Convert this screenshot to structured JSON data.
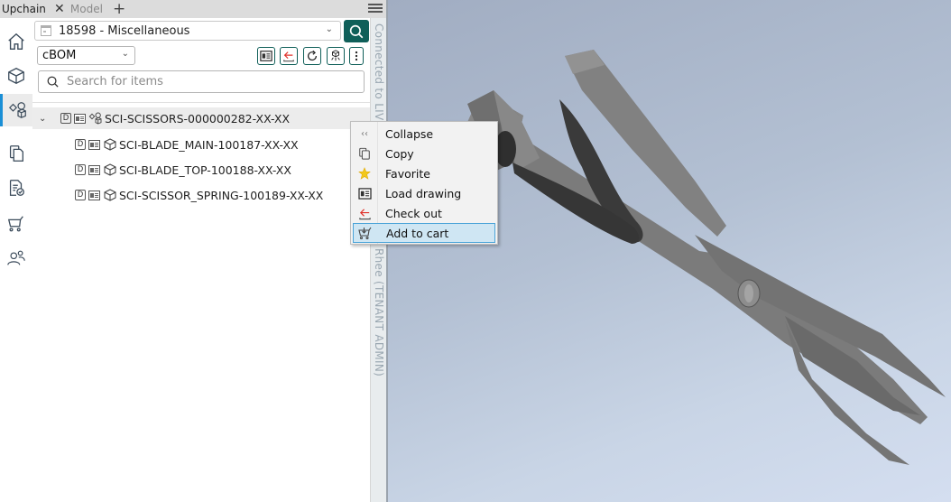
{
  "tabs": [
    {
      "label": "Upchain",
      "active": true
    },
    {
      "label": "Model",
      "active": false
    }
  ],
  "tab_add_icon": "plus-icon",
  "menu_icon": "hamburger-icon",
  "leftnav": [
    {
      "id": "home",
      "icon": "home-icon",
      "active": false
    },
    {
      "id": "parts",
      "icon": "cube-icon",
      "active": false
    },
    {
      "id": "assemblies",
      "icon": "assembly-icon",
      "active": true
    },
    {
      "id": "documents",
      "icon": "documents-icon",
      "active": false
    },
    {
      "id": "approvals",
      "icon": "document-check-icon",
      "active": false
    },
    {
      "id": "cart",
      "icon": "cart-icon",
      "active": false
    },
    {
      "id": "users",
      "icon": "users-icon",
      "active": false
    }
  ],
  "project": {
    "selected": "18598 - Miscellaneous"
  },
  "bom": {
    "selected": "cBOM"
  },
  "toolbar": [
    {
      "id": "load-drawing",
      "icon": "drawing-icon"
    },
    {
      "id": "check-out",
      "icon": "check-out-icon"
    },
    {
      "id": "refresh",
      "icon": "refresh-icon"
    },
    {
      "id": "assembly-tree",
      "icon": "assembly-tree-icon"
    },
    {
      "id": "more",
      "icon": "more-vertical-icon"
    }
  ],
  "search": {
    "placeholder": "Search for items",
    "value": ""
  },
  "tree": {
    "root": {
      "label": "SCI-SCISSORS-000000282-XX-XX",
      "badge": "D",
      "expanded": true
    },
    "children": [
      {
        "label": "SCI-BLADE_MAIN-100187-XX-XX",
        "badge": "D"
      },
      {
        "label": "SCI-BLADE_TOP-100188-XX-XX",
        "badge": "D"
      },
      {
        "label": "SCI-SCISSOR_SPRING-100189-XX-XX",
        "badge": "D"
      }
    ]
  },
  "status": {
    "text_top": "Connected to LIVE",
    "text_bottom": "Rhee (TENANT ADMIN)"
  },
  "context_menu": [
    {
      "label": "Collapse",
      "icon": "collapse-icon"
    },
    {
      "label": "Copy",
      "icon": "copy-icon"
    },
    {
      "label": "Favorite",
      "icon": "star-icon"
    },
    {
      "label": "Load drawing",
      "icon": "drawing-icon"
    },
    {
      "label": "Check out",
      "icon": "check-out-icon"
    },
    {
      "label": "Add to cart",
      "icon": "add-to-cart-icon",
      "highlighted": true
    }
  ],
  "colors": {
    "accent": "#0f5f59",
    "nav_active": "#1a8fd6",
    "checkout_red": "#e0322b",
    "star": "#f2c81b",
    "menu_highlight": "#cfe6f3"
  }
}
